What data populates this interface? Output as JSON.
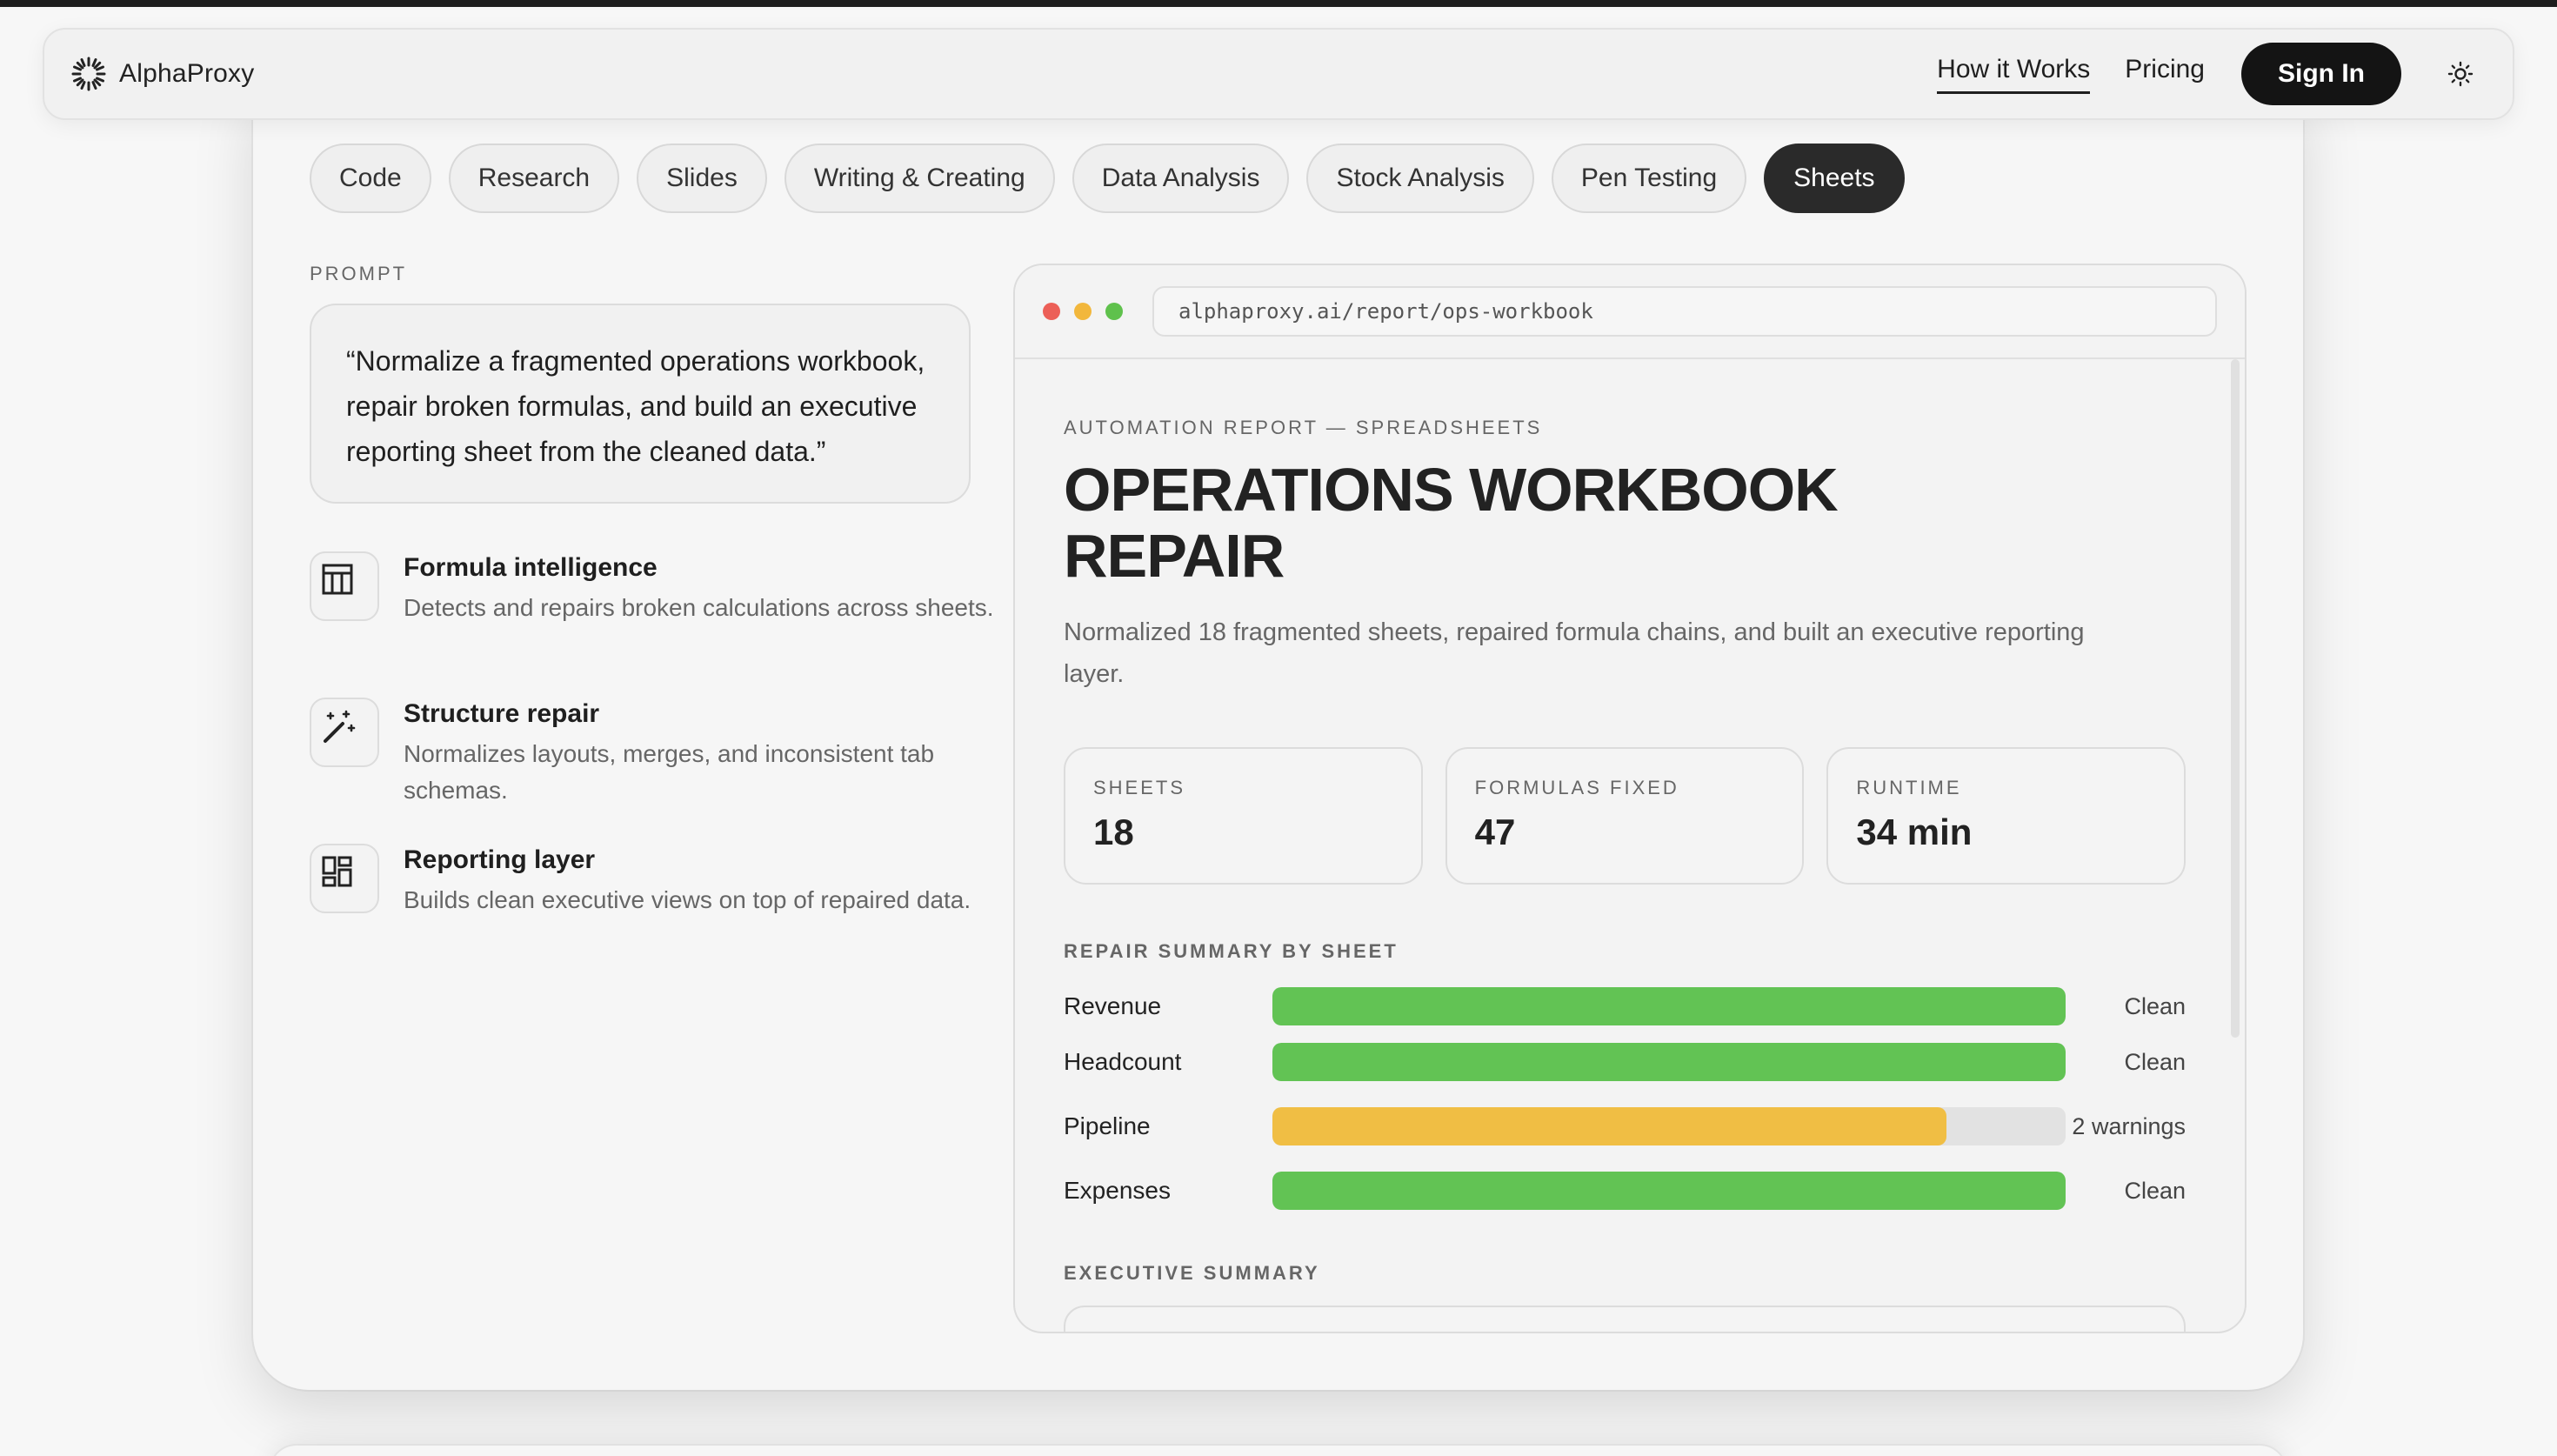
{
  "nav": {
    "brand": "AlphaProxy",
    "links": [
      {
        "label": "How it Works",
        "active": true
      },
      {
        "label": "Pricing",
        "active": false
      }
    ],
    "signin": "Sign In",
    "theme_icon": "sun-icon"
  },
  "tabs": [
    {
      "label": "Code",
      "active": false
    },
    {
      "label": "Research",
      "active": false
    },
    {
      "label": "Slides",
      "active": false
    },
    {
      "label": "Writing & Creating",
      "active": false
    },
    {
      "label": "Data Analysis",
      "active": false
    },
    {
      "label": "Stock Analysis",
      "active": false
    },
    {
      "label": "Pen Testing",
      "active": false
    },
    {
      "label": "Sheets",
      "active": true
    }
  ],
  "prompt": {
    "label": "PROMPT",
    "text": "“Normalize a fragmented operations workbook, repair broken formulas, and build an executive reporting sheet from the cleaned data.”"
  },
  "features": [
    {
      "icon": "table-icon",
      "title": "Formula intelligence",
      "desc": "Detects and repairs broken calculations across sheets."
    },
    {
      "icon": "magic-wand-icon",
      "title": "Structure repair",
      "desc": "Normalizes layouts, merges, and inconsistent tab schemas."
    },
    {
      "icon": "dashboard-icon",
      "title": "Reporting layer",
      "desc": "Builds clean executive views on top of repaired data."
    }
  ],
  "browser": {
    "url": "alphaproxy.ai/report/ops-workbook",
    "dots": [
      "#ec5f57",
      "#f2b73c",
      "#5fc14c"
    ]
  },
  "report": {
    "eyebrow": "AUTOMATION REPORT — SPREADSHEETS",
    "title": "OPERATIONS WORKBOOK REPAIR",
    "desc": "Normalized 18 fragmented sheets, repaired formula chains, and built an executive reporting layer.",
    "stats": [
      {
        "label": "SHEETS",
        "value": "18"
      },
      {
        "label": "FORMULAS FIXED",
        "value": "47"
      },
      {
        "label": "RUNTIME",
        "value": "34 min"
      }
    ],
    "repair_label": "REPAIR SUMMARY BY SHEET",
    "repair_rows": [
      {
        "name": "Revenue",
        "progress": 1.0,
        "color": "#62c354",
        "status": "Clean"
      },
      {
        "name": "Headcount",
        "progress": 1.0,
        "color": "#62c354",
        "status": "Clean"
      },
      {
        "name": "Pipeline",
        "progress": 0.85,
        "color": "#f0be44",
        "status": "2 warnings"
      },
      {
        "name": "Expenses",
        "progress": 1.0,
        "color": "#62c354",
        "status": "Clean"
      }
    ],
    "exec_label": "EXECUTIVE SUMMARY"
  }
}
